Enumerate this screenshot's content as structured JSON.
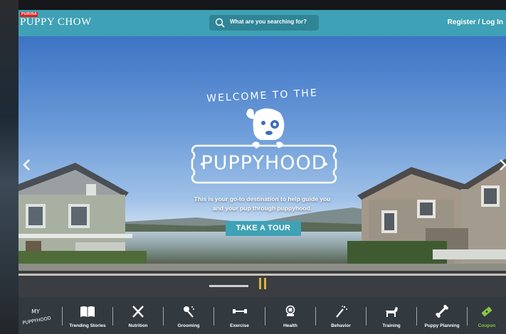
{
  "header": {
    "logo_top": "PURINA",
    "logo_brand": "PUPPY CHOW",
    "search_placeholder": "What are you searching for?",
    "auth_label": "Register / Log In"
  },
  "hero": {
    "welcome": "WELCOME TO THE",
    "sign": "PUPPYHOOD",
    "tagline_1": "This is your go-to destination to help guide you",
    "tagline_2": "and your pup through puppyhood.",
    "cta": "TAKE A TOUR"
  },
  "nav": {
    "brand_1": "MY",
    "brand_2": "PUPPYHOOD",
    "items": [
      {
        "label": "Trending Stories",
        "icon": "book-icon"
      },
      {
        "label": "Nutrition",
        "icon": "utensils-icon"
      },
      {
        "label": "Grooming",
        "icon": "brush-icon"
      },
      {
        "label": "Exercise",
        "icon": "dumbbell-icon"
      },
      {
        "label": "Health",
        "icon": "stethoscope-icon"
      },
      {
        "label": "Behavior",
        "icon": "wand-icon"
      },
      {
        "label": "Training",
        "icon": "dog-icon"
      },
      {
        "label": "Puppy Planning",
        "icon": "bone-icon"
      },
      {
        "label": "Coupon",
        "icon": "coupon-icon"
      }
    ]
  },
  "colors": {
    "brand_teal": "#3fa1b5",
    "nav_bg": "#32393f",
    "coupon_green": "#8bc53f"
  }
}
